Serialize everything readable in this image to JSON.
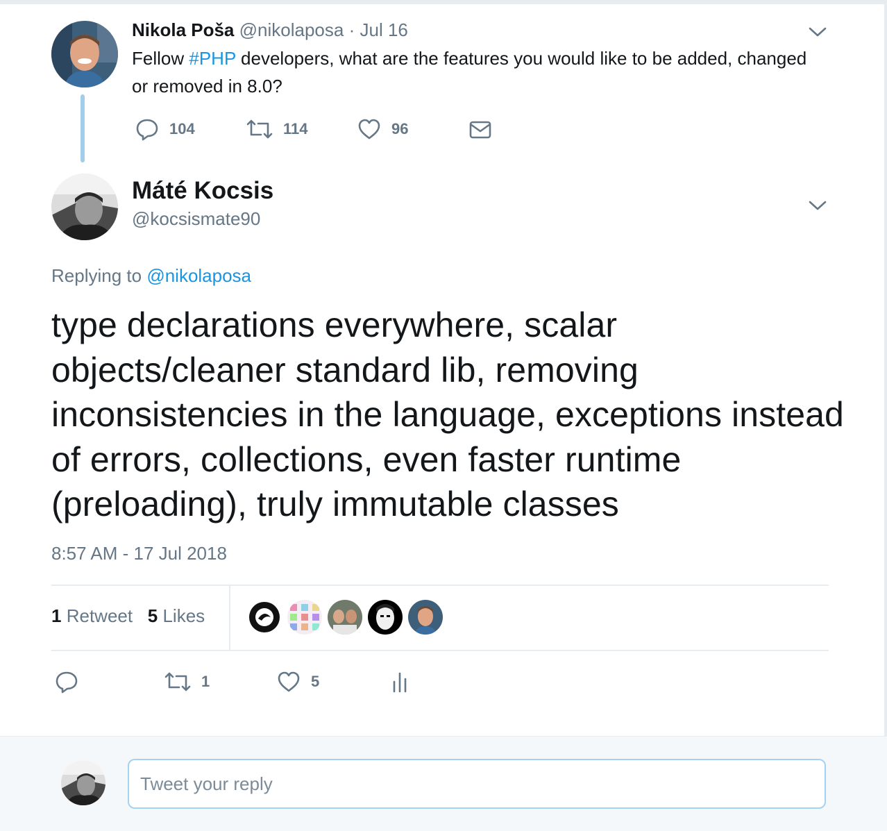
{
  "parent_tweet": {
    "display_name": "Nikola Poša",
    "handle": "@nikolaposa",
    "separator": "·",
    "date": "Jul 16",
    "text_before": "Fellow ",
    "hashtag": "#PHP",
    "text_after": " developers, what are the features you would like to be added, changed or removed in 8.0?",
    "replies": "104",
    "retweets": "114",
    "likes": "96",
    "icons": [
      "reply-icon",
      "retweet-icon",
      "like-icon",
      "direct-message-icon",
      "chevron-down-icon"
    ]
  },
  "main_tweet": {
    "display_name": "Máté Kocsis",
    "handle": "@kocsismate90",
    "replying_label": "Replying to",
    "replying_handle": "@nikolaposa",
    "text": "type declarations everywhere, scalar objects/cleaner standard lib, removing inconsistencies in the language, exceptions instead of errors, collections, even faster runtime (preloading), truly immutable classes",
    "timestamp": "8:57 AM - 17 Jul 2018",
    "retweet_count": "1",
    "retweet_label": "Retweet",
    "like_count": "5",
    "like_label": "Likes",
    "action_retweets": "1",
    "action_likes": "5",
    "icons": [
      "reply-icon",
      "retweet-icon",
      "like-icon",
      "analytics-icon",
      "chevron-down-icon"
    ]
  },
  "reply_box": {
    "placeholder": "Tweet your reply"
  },
  "colors": {
    "link": "#1b95e0",
    "muted": "#657786",
    "thread_line": "#a3cde8",
    "text": "#14171a"
  }
}
